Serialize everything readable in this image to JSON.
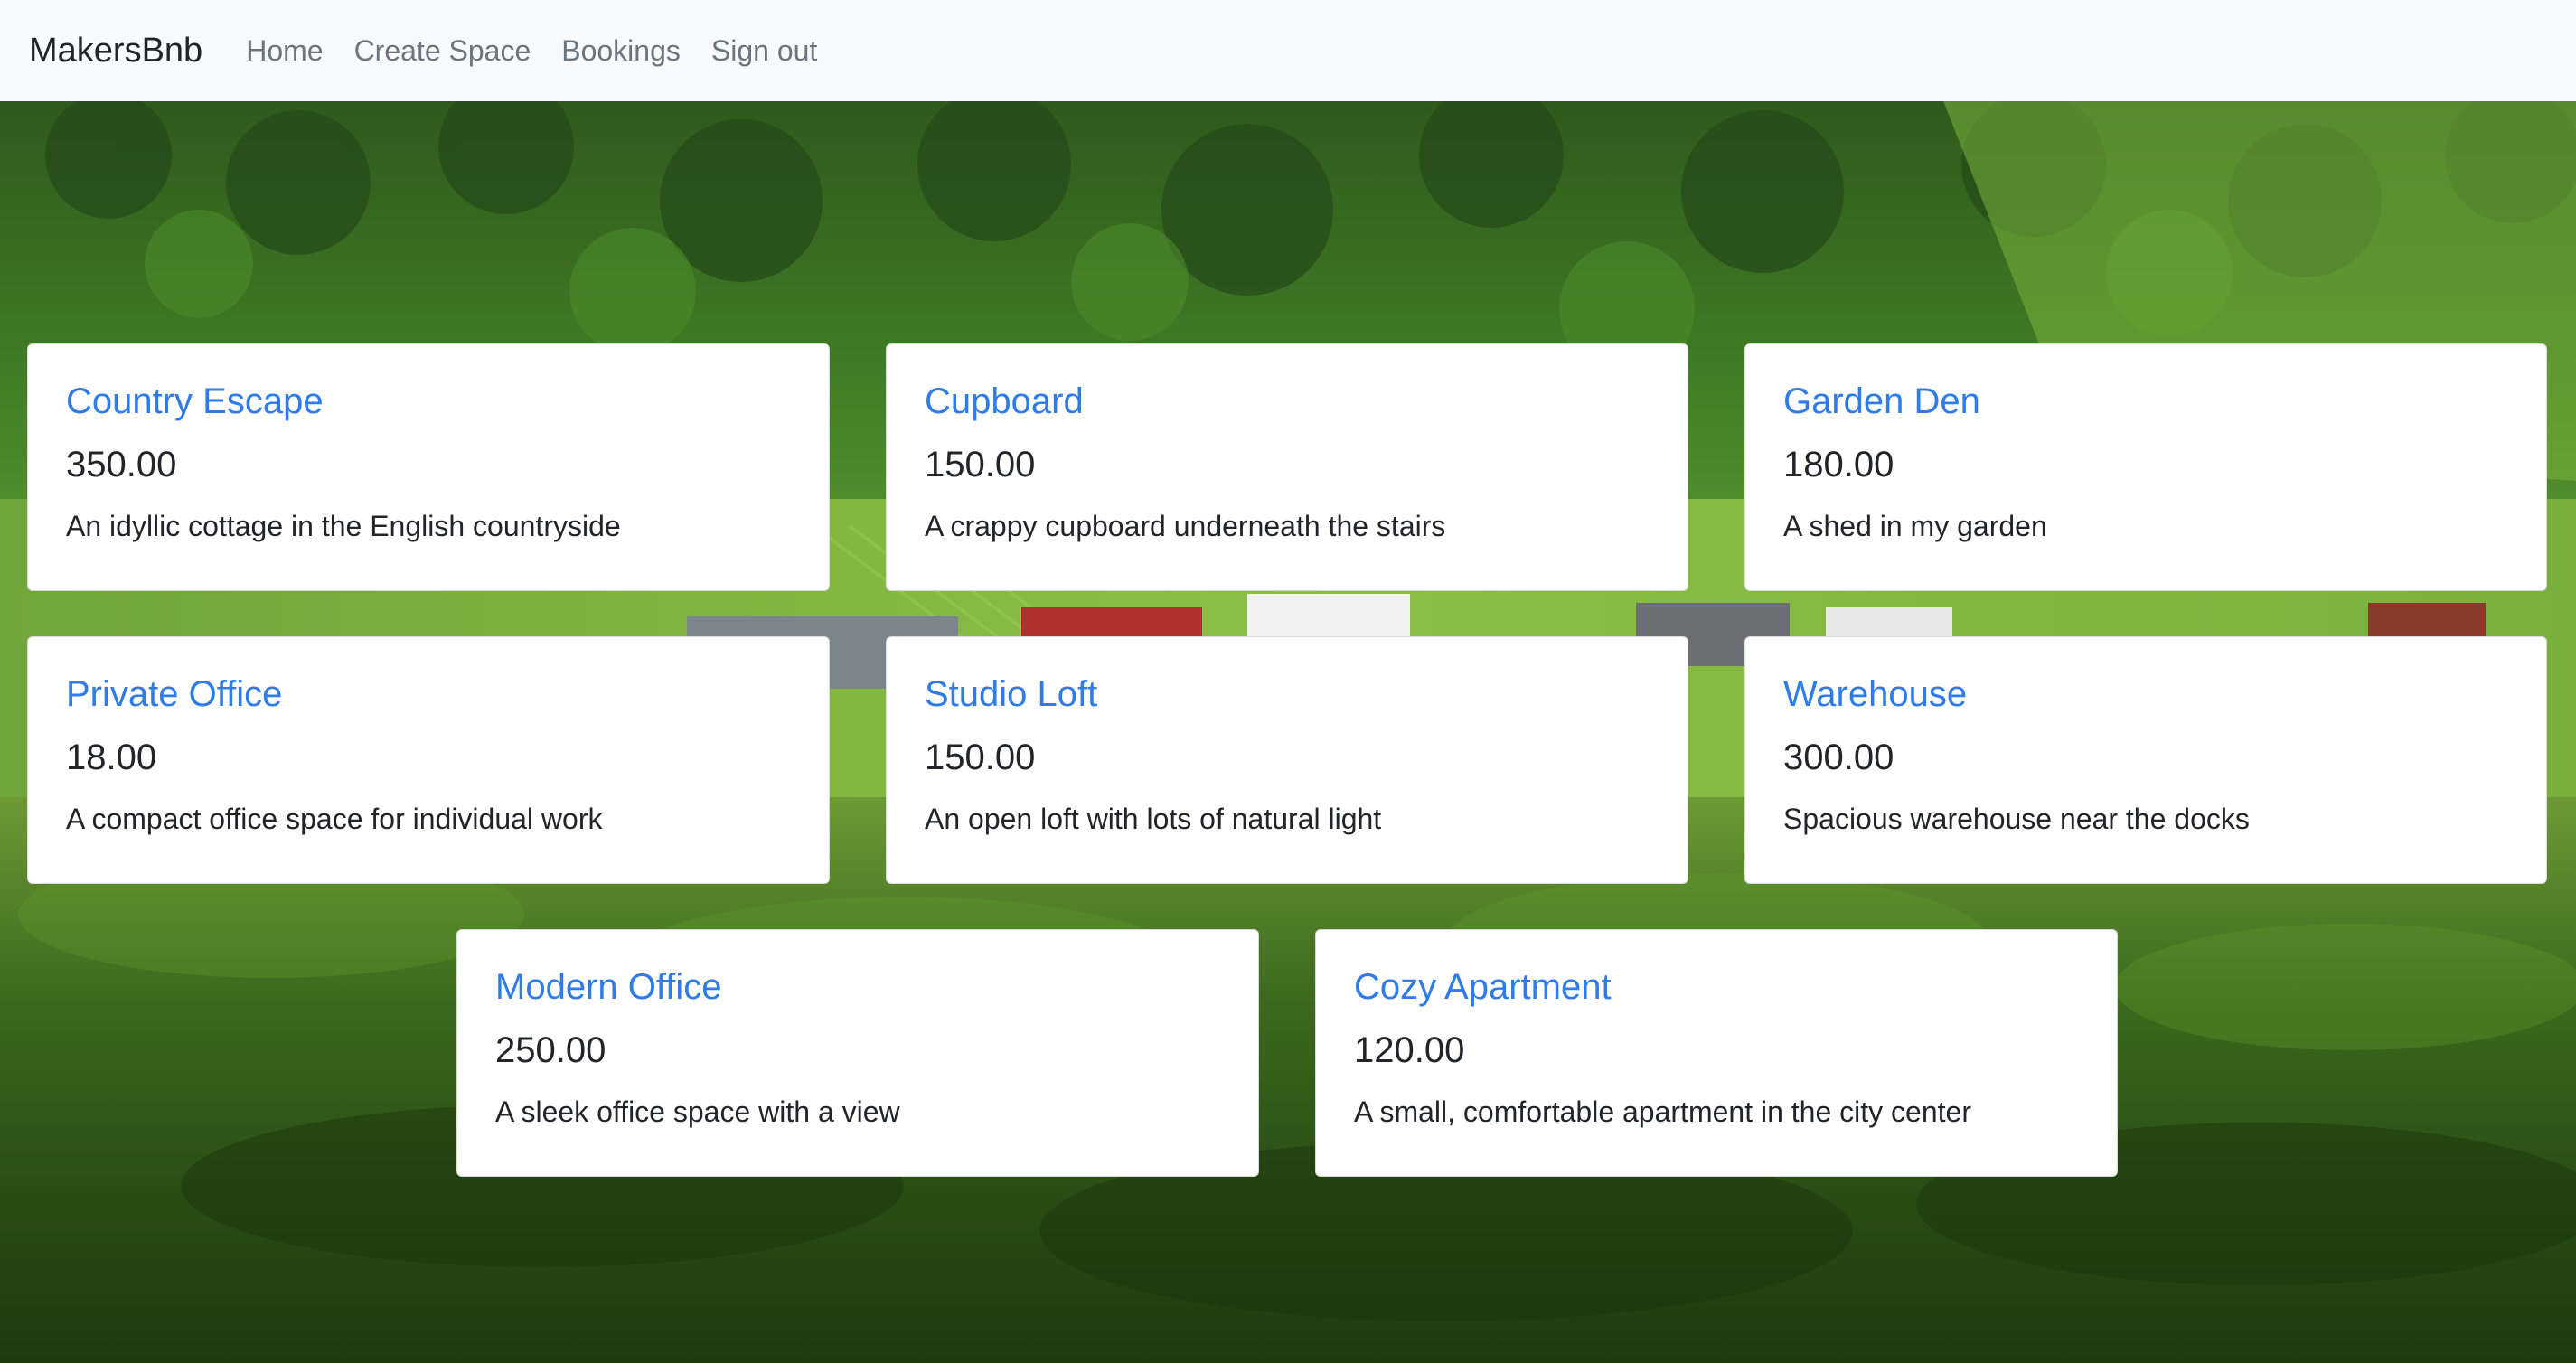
{
  "nav": {
    "brand": "MakersBnb",
    "links": [
      "Home",
      "Create Space",
      "Bookings",
      "Sign out"
    ]
  },
  "spaces": [
    {
      "name": "Country Escape",
      "price": "350.00",
      "description": "An idyllic cottage in the English countryside"
    },
    {
      "name": "Cupboard",
      "price": "150.00",
      "description": "A crappy cupboard underneath the stairs"
    },
    {
      "name": "Garden Den",
      "price": "180.00",
      "description": "A shed in my garden"
    },
    {
      "name": "Private Office",
      "price": "18.00",
      "description": "A compact office space for individual work"
    },
    {
      "name": "Studio Loft",
      "price": "150.00",
      "description": "An open loft with lots of natural light"
    },
    {
      "name": "Warehouse",
      "price": "300.00",
      "description": "Spacious warehouse near the docks"
    },
    {
      "name": "Modern Office",
      "price": "250.00",
      "description": "A sleek office space with a view"
    },
    {
      "name": "Cozy Apartment",
      "price": "120.00",
      "description": "A small, comfortable apartment in the city center"
    }
  ],
  "colors": {
    "link": "#2f7bea",
    "navbar_bg": "#f8f9fa",
    "nav_link": "#6c757d"
  }
}
